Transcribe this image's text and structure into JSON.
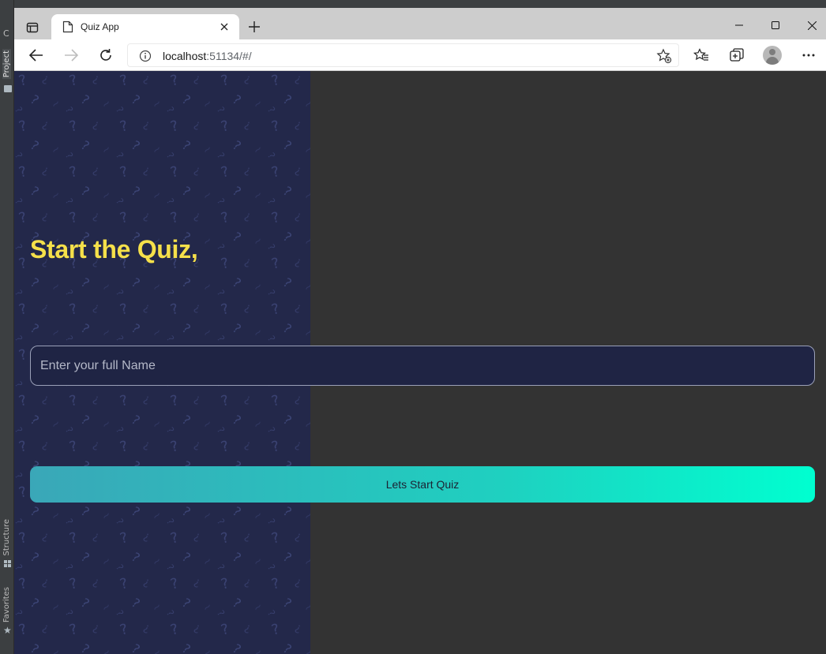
{
  "ide": {
    "letter": "C",
    "tabs": {
      "project": "Project",
      "structure": "Structure",
      "favorites": "Favorites"
    }
  },
  "browser": {
    "tab_title": "Quiz App",
    "url_host": "localhost",
    "url_rest": ":51134/#/"
  },
  "page": {
    "heading": "Start the Quiz,",
    "name_placeholder": "Enter your full Name",
    "name_value": "",
    "start_button": "Lets Start Quiz"
  },
  "colors": {
    "panel_bg": "#23284a",
    "heading": "#f5e04a",
    "button_start": "#3aa7b8",
    "button_end": "#00ffd0",
    "page_bg": "#333333"
  }
}
